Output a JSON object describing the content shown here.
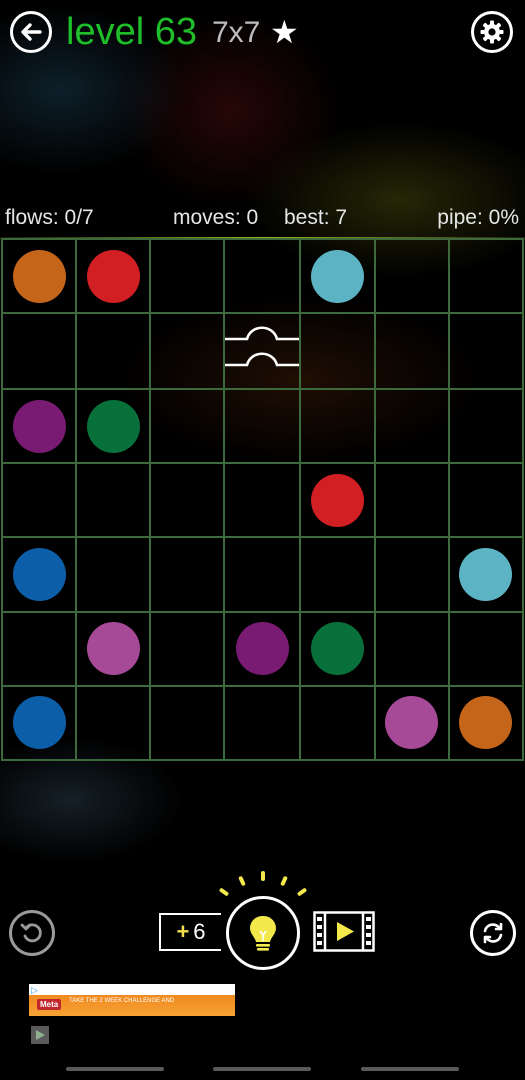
{
  "header": {
    "level_label": "level 63",
    "grid_size": "7x7",
    "star": "★"
  },
  "stats": {
    "flows": "flows: 0/7",
    "moves": "moves: 0",
    "best": "best: 7",
    "pipe": "pipe: 0%"
  },
  "colors": {
    "orange": "#c4651a",
    "red": "#d11f23",
    "cyan": "#5cb3c4",
    "purple": "#7a1b73",
    "green": "#08703a",
    "blue": "#0d5ea8",
    "pink": "#a64a98",
    "grid_line": "#3d6a3d",
    "title_green": "#1fbf2a",
    "hint_yellow": "#f5e04a"
  },
  "board": {
    "rows": 7,
    "cols": 7,
    "dots": [
      {
        "row": 0,
        "col": 0,
        "color": "orange"
      },
      {
        "row": 0,
        "col": 1,
        "color": "red"
      },
      {
        "row": 0,
        "col": 4,
        "color": "cyan"
      },
      {
        "row": 2,
        "col": 0,
        "color": "purple"
      },
      {
        "row": 2,
        "col": 1,
        "color": "green"
      },
      {
        "row": 3,
        "col": 4,
        "color": "red"
      },
      {
        "row": 4,
        "col": 0,
        "color": "blue"
      },
      {
        "row": 4,
        "col": 6,
        "color": "cyan"
      },
      {
        "row": 5,
        "col": 1,
        "color": "pink"
      },
      {
        "row": 5,
        "col": 3,
        "color": "purple"
      },
      {
        "row": 5,
        "col": 4,
        "color": "green"
      },
      {
        "row": 6,
        "col": 0,
        "color": "blue"
      },
      {
        "row": 6,
        "col": 5,
        "color": "pink"
      },
      {
        "row": 6,
        "col": 6,
        "color": "orange"
      }
    ],
    "bridges": [
      {
        "row": 1,
        "col": 3
      }
    ]
  },
  "controls": {
    "hint_plus": "+",
    "hint_count": "6",
    "icons": [
      "back-arrow-icon",
      "gear-icon",
      "undo-icon",
      "lightbulb-icon",
      "video-play-icon",
      "restart-icon"
    ]
  },
  "ad": {
    "brand": "Meta",
    "headline": "TAKE THE 2 WEEK CHALLENGE AND"
  }
}
